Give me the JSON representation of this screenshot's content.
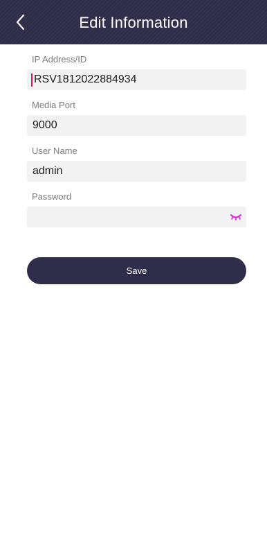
{
  "header": {
    "title": "Edit Information",
    "back_icon": "chevron-left-icon",
    "background_color": "#2f2d4a"
  },
  "form": {
    "fields": [
      {
        "label": "IP Address/ID",
        "value": "RSV1812022884934",
        "focused": true
      },
      {
        "label": "Media Port",
        "value": "9000"
      },
      {
        "label": "User Name",
        "value": "admin"
      },
      {
        "label": "Password",
        "value": "",
        "toggle_icon": "eye-closed-icon"
      }
    ]
  },
  "save_button": {
    "label": "Save"
  },
  "colors": {
    "accent": "#2f2d4a",
    "caret": "#e0185c",
    "eye_icon": "#e020d8",
    "field_background": "#f2f2f2"
  }
}
